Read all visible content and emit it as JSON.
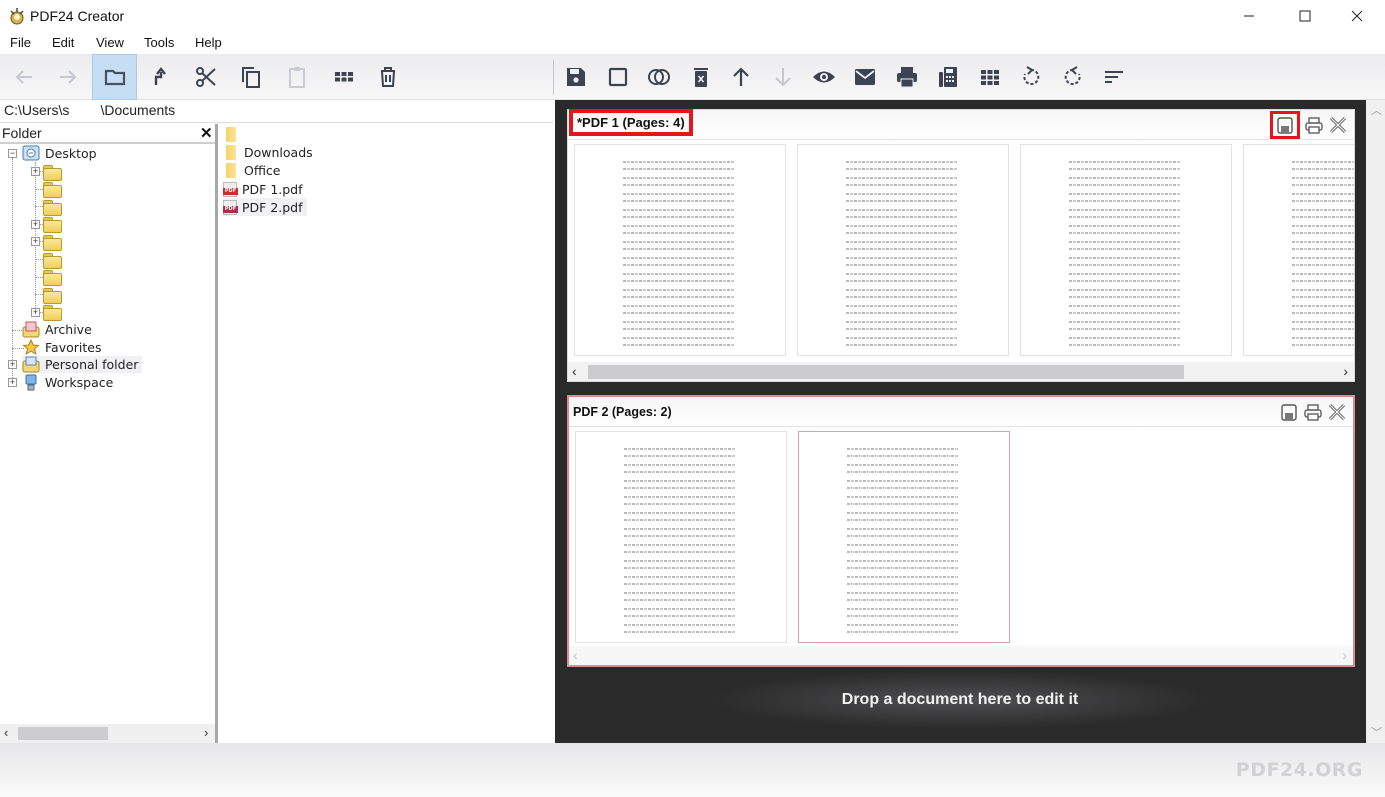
{
  "window": {
    "title": "PDF24 Creator",
    "controls": {
      "minimize": "minimize",
      "maximize": "maximize",
      "close": "close"
    }
  },
  "menu": [
    "File",
    "Edit",
    "View",
    "Tools",
    "Help"
  ],
  "toolbar_left": [
    {
      "name": "back",
      "icon": "arrow-left-icon",
      "enabled": false
    },
    {
      "name": "forward",
      "icon": "arrow-right-icon",
      "enabled": false
    },
    {
      "name": "folders",
      "icon": "folder-icon",
      "enabled": true,
      "active": true
    },
    {
      "name": "up",
      "icon": "up-level-icon",
      "enabled": true
    },
    {
      "name": "cut",
      "icon": "scissors-icon",
      "enabled": true
    },
    {
      "name": "copy",
      "icon": "copy-icon",
      "enabled": true
    },
    {
      "name": "paste",
      "icon": "clipboard-icon",
      "enabled": false
    },
    {
      "name": "view-mode",
      "icon": "grid-icon",
      "enabled": true
    },
    {
      "name": "delete",
      "icon": "trash-icon",
      "enabled": true
    }
  ],
  "toolbar_right": [
    {
      "name": "save",
      "icon": "floppy-icon"
    },
    {
      "name": "select-all",
      "icon": "square-icon"
    },
    {
      "name": "merge",
      "icon": "merge-circles-icon"
    },
    {
      "name": "delete-page",
      "icon": "trash-x-icon"
    },
    {
      "name": "move-up",
      "icon": "arrow-up-icon"
    },
    {
      "name": "move-down",
      "icon": "arrow-down-icon",
      "enabled": false
    },
    {
      "name": "preview",
      "icon": "eye-icon"
    },
    {
      "name": "email",
      "icon": "envelope-icon"
    },
    {
      "name": "print",
      "icon": "printer-icon"
    },
    {
      "name": "fax",
      "icon": "fax-icon"
    },
    {
      "name": "layout",
      "icon": "grid-icon"
    },
    {
      "name": "rotate-left",
      "icon": "rotate-ccw-icon"
    },
    {
      "name": "rotate-right",
      "icon": "rotate-cw-icon"
    },
    {
      "name": "sort",
      "icon": "sort-lines-icon"
    }
  ],
  "path": {
    "value": "C:\\Users\\s        \\Documents"
  },
  "folder_panel": {
    "title": "Folder",
    "close_label": "✕",
    "tree": [
      {
        "label": "Desktop",
        "icon": "desktop-icon",
        "expanded": true,
        "children_count": 9
      },
      {
        "label": "Archive",
        "icon": "archive-icon"
      },
      {
        "label": "Favorites",
        "icon": "star-icon"
      },
      {
        "label": "Personal folder",
        "icon": "personal-folder-icon",
        "selected": true
      },
      {
        "label": "Workspace",
        "icon": "workspace-icon"
      }
    ],
    "desktop_children": [
      {
        "label": "",
        "expandable": true
      },
      {
        "label": "",
        "expandable": false
      },
      {
        "label": "",
        "expandable": false
      },
      {
        "label": "",
        "expandable": true
      },
      {
        "label": "",
        "expandable": true
      },
      {
        "label": "",
        "expandable": false
      },
      {
        "label": "",
        "expandable": false
      },
      {
        "label": "",
        "expandable": false
      },
      {
        "label": "",
        "expandable": true
      }
    ]
  },
  "file_list": [
    {
      "name": "",
      "type": "folder"
    },
    {
      "name": "Downloads",
      "type": "folder"
    },
    {
      "name": "Office",
      "type": "folder"
    },
    {
      "name": "PDF 1.pdf",
      "type": "pdf"
    },
    {
      "name": "PDF 2.pdf",
      "type": "pdf",
      "selected": true
    }
  ],
  "editor": {
    "documents": [
      {
        "title": "*PDF 1 (Pages: 4)",
        "pages": 4,
        "modified": true,
        "highlight_title": true,
        "highlight_save": true
      },
      {
        "title": "PDF 2 (Pages: 2)",
        "pages": 2,
        "modified": false,
        "selected_page": 2
      }
    ],
    "doc_actions": [
      "save",
      "print",
      "close"
    ],
    "drop_hint": "Drop a document here to edit it"
  },
  "brand": "PDF24.ORG",
  "colors": {
    "accent_highlight": "#e8141c",
    "editor_bg": "#2a2a2b",
    "active_tool": "#c6def3",
    "selected_doc_border": "#d98d93"
  }
}
